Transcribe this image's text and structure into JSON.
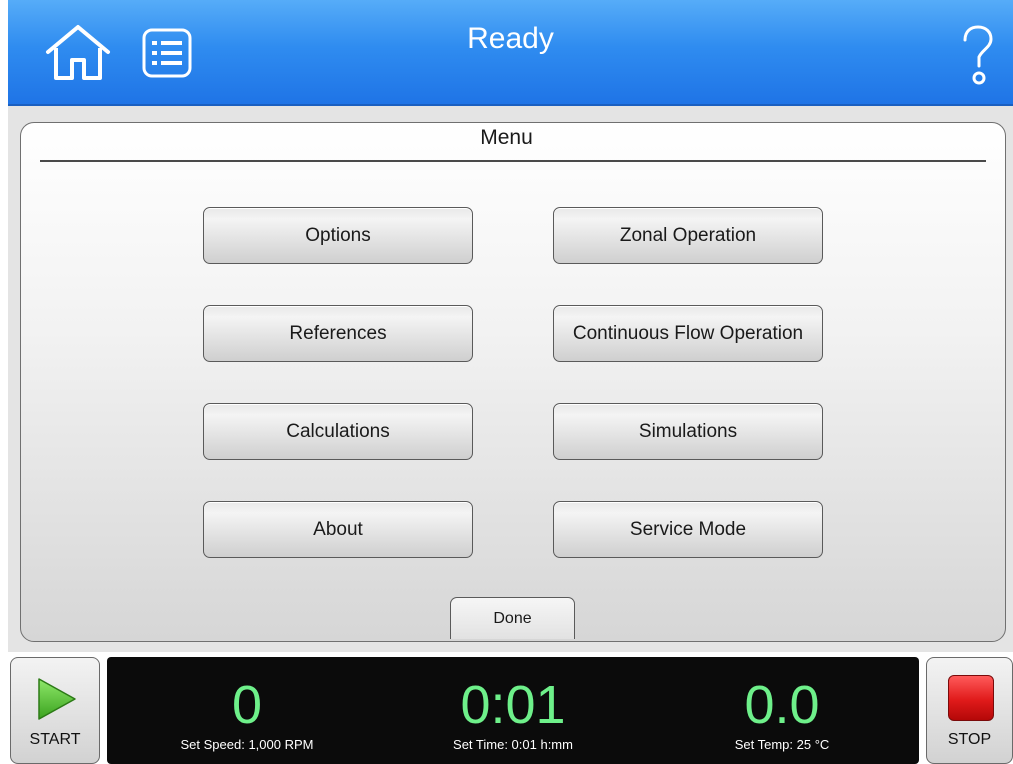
{
  "header": {
    "title": "Ready",
    "home_icon": "home-icon",
    "list_icon": "list-icon",
    "help_icon": "help-icon"
  },
  "panel": {
    "title": "Menu",
    "buttons": [
      {
        "label": "Options"
      },
      {
        "label": "Zonal Operation"
      },
      {
        "label": "References"
      },
      {
        "label": "Continuous Flow Operation"
      },
      {
        "label": "Calculations"
      },
      {
        "label": "Simulations"
      },
      {
        "label": "About"
      },
      {
        "label": "Service Mode"
      }
    ],
    "done_label": "Done"
  },
  "controls": {
    "start_label": "START",
    "stop_label": "STOP",
    "start_icon": "play-icon",
    "stop_icon": "stop-icon"
  },
  "status": {
    "speed": {
      "value": "0",
      "set_label": "Set Speed: 1,000 RPM"
    },
    "time": {
      "value": "0:01",
      "set_label": "Set Time: 0:01 h:mm"
    },
    "temp": {
      "value": "0.0",
      "set_label": "Set Temp: 25 °C"
    }
  },
  "colors": {
    "header_blue": "#2f8cf0",
    "readout_green": "#6ef08a",
    "stop_red": "#e01a1a",
    "start_green": "#5cc83a"
  }
}
